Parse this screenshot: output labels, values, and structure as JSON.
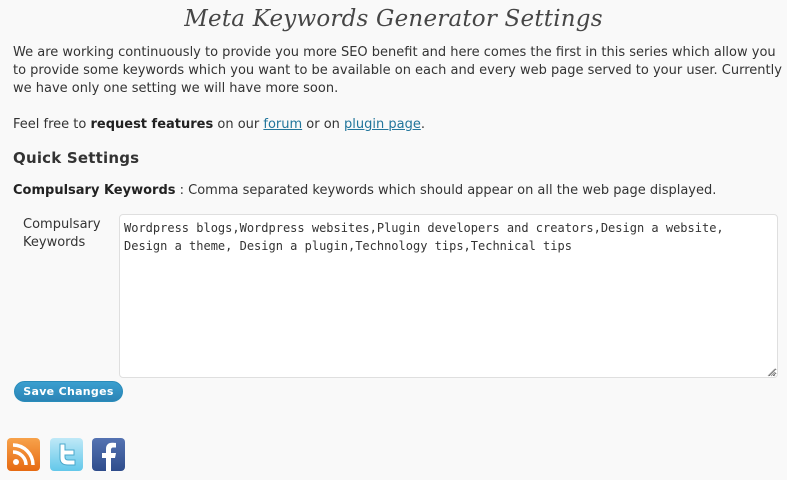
{
  "page": {
    "title": "Meta Keywords Generator Settings",
    "intro": "We are working continuously to provide you more SEO benefit and here comes the first in this series which allow you to provide some keywords which you want to be available on each and every web page served to your user. Currently we have only one setting we will have more soon.",
    "request": {
      "prefix": "Feel free to ",
      "bold": "request features",
      "mid1": " on our ",
      "forum_link": "forum",
      "mid2": " or on ",
      "plugin_link": "plugin page",
      "suffix": "."
    }
  },
  "quick_settings": {
    "heading": "Quick Settings",
    "desc_bold": "Compulsary Keywords",
    "desc_text": " : Comma separated keywords which should appear on all the web page displayed.",
    "field_label": "Compulsary Keywords",
    "field_value": "Wordpress blogs,Wordpress websites,Plugin developers and creators,Design a website, Design a theme, Design a plugin,Technology tips,Technical tips"
  },
  "actions": {
    "save_label": "Save Changes"
  },
  "social": {
    "icons": [
      "rss-icon",
      "twitter-icon",
      "facebook-icon"
    ],
    "colors": {
      "rss": "#f08a2c",
      "twitter": "#63c8ea",
      "facebook": "#3b5998"
    }
  },
  "colors": {
    "background": "#f9f9f9",
    "link": "#21759b",
    "button": "#2b84b6"
  }
}
